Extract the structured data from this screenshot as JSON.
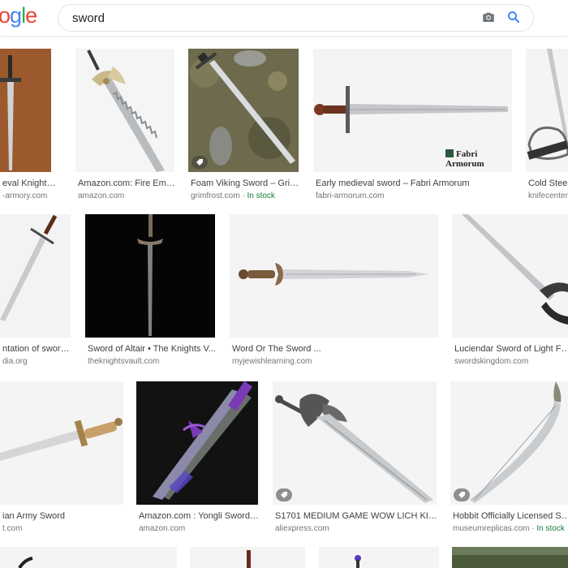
{
  "logo": {
    "text_parts": [
      "o",
      "g",
      "l",
      "e"
    ],
    "colors": [
      "#ea4335",
      "#4285f4",
      "#34a853",
      "#ea4335"
    ]
  },
  "search": {
    "query": "sword",
    "camera_icon": "camera-icon",
    "search_icon": "magnifier-icon"
  },
  "results": [
    {
      "title": "eval Knight S...",
      "source": "-armory.com"
    },
    {
      "title": "Amazon.com: Fire Emb...",
      "source": "amazon.com"
    },
    {
      "title": "Foam Viking Sword – Grim...",
      "source": "grimfrost.com",
      "badge": "In stock"
    },
    {
      "title": "Early medieval sword – Fabri Armorum",
      "source": "fabri-armorum.com",
      "watermark": "Fabri Armorum"
    },
    {
      "title": "Cold Steel",
      "source": "knifecenter"
    },
    {
      "title": "ntation of swords -...",
      "source": "dia.org"
    },
    {
      "title": "Sword of Altair • The Knights V...",
      "source": "theknightsvault.com"
    },
    {
      "title": "Word Or The Sword ...",
      "source": "myjewishlearning.com"
    },
    {
      "title": "Luciendar Sword of Light For S",
      "source": "swordskingdom.com"
    },
    {
      "title": "ian Army Sword",
      "source": "t.com"
    },
    {
      "title": "Amazon.com : Yongli Sword ...",
      "source": "amazon.com"
    },
    {
      "title": "S1701 MEDIUM GAME WOW LICH KING ...",
      "source": "aliexpress.com"
    },
    {
      "title": "Hobbit Officially Licensed Sw...",
      "source": "museumreplicas.com",
      "badge": "In stock"
    }
  ],
  "separator": " · "
}
